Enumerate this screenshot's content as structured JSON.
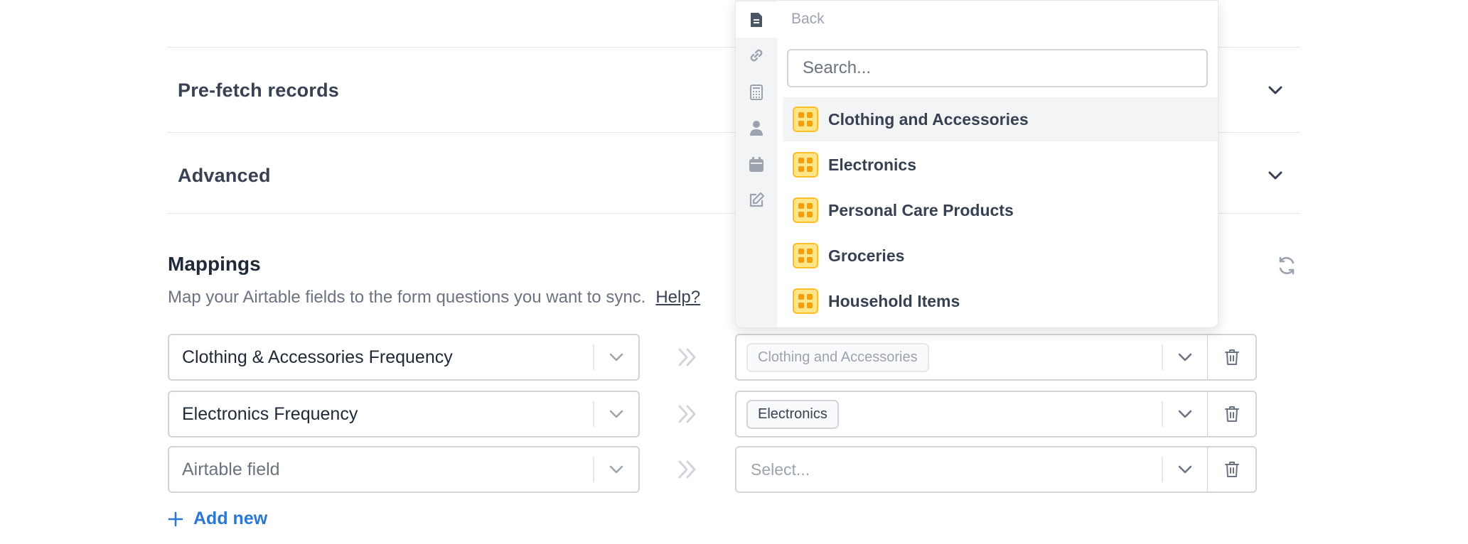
{
  "sections": [
    {
      "title": "Pre-fetch records"
    },
    {
      "title": "Advanced"
    }
  ],
  "mappings": {
    "title": "Mappings",
    "description": "Map your Airtable fields to the form questions you want to sync.",
    "help_link": "Help?",
    "rows": [
      {
        "airtable_field": "Clothing & Accessories Frequency",
        "form_question": "Clothing and Accessories"
      },
      {
        "airtable_field": "Electronics Frequency",
        "form_question": "Electronics"
      },
      {
        "airtable_field_placeholder": "Airtable field",
        "form_question_placeholder": "Select..."
      }
    ],
    "add_new_label": "Add new"
  },
  "dropdown": {
    "back_label": "Back",
    "search_placeholder": "Search...",
    "rail_icons": [
      "document-icon",
      "link-icon",
      "calculator-icon",
      "person-icon",
      "calendar-icon",
      "edit-icon"
    ],
    "options": [
      {
        "label": "Clothing and Accessories"
      },
      {
        "label": "Electronics"
      },
      {
        "label": "Personal Care Products"
      },
      {
        "label": "Groceries"
      },
      {
        "label": "Household Items"
      }
    ]
  },
  "colors": {
    "accent": "#2b77d4",
    "option_icon": "#fbbf24"
  }
}
